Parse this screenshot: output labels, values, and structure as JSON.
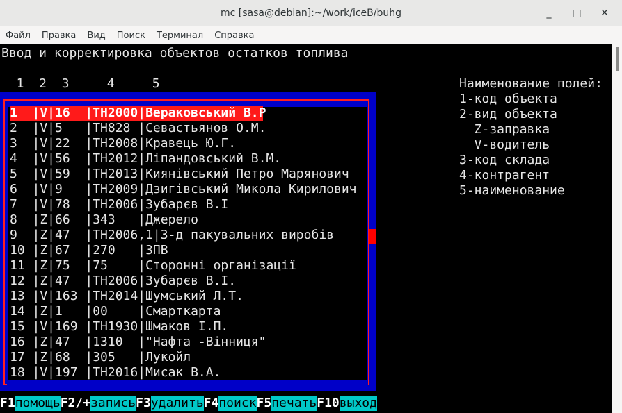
{
  "window": {
    "title": "mc [sasa@debian]:~/work/iceB/buhg",
    "controls": [
      "_",
      "□",
      "✕"
    ]
  },
  "menu": [
    "Файл",
    "Правка",
    "Вид",
    "Поиск",
    "Терминал",
    "Справка"
  ],
  "screen": {
    "heading": "Ввод и корректировка объектов остатков топлива",
    "column_numbers": "  1  2  3     4     5",
    "rows": [
      {
        "text": "1  |V|16  |TH2000|Вераковський В.Р",
        "selected": true
      },
      {
        "text": "2  |V|5   |TH828 |Севастьянов О.М."
      },
      {
        "text": "3  |V|22  |TH2008|Кравець Ю.Г."
      },
      {
        "text": "4  |V|56  |TH2012|Ліпандовський В.М."
      },
      {
        "text": "5  |V|59  |TH2013|Киянівський Петро Марянович"
      },
      {
        "text": "6  |V|9   |TH2009|Дзигівський Микола Кирилович"
      },
      {
        "text": "7  |V|78  |TH2006|Зубарєв В.І"
      },
      {
        "text": "8  |Z|66  |343   |Джерело"
      },
      {
        "text": "9  |Z|47  |TH2006,1|3-д пакувальних виробів"
      },
      {
        "text": "10 |Z|67  |270   |ЗПВ"
      },
      {
        "text": "11 |Z|75  |75    |Сторонні організації"
      },
      {
        "text": "12 |Z|47  |TH2006|Зубарєв В.І."
      },
      {
        "text": "13 |V|163 |TH2014|Шумський Л.Т."
      },
      {
        "text": "14 |Z|1   |00    |Смарткарта"
      },
      {
        "text": "15 |V|169 |TH1930|Шмаков І.П."
      },
      {
        "text": "16 |Z|47  |1310  |\"Нафта -Вінниця\""
      },
      {
        "text": "17 |Z|68  |305   |Лукойл"
      },
      {
        "text": "18 |V|197 |TH2016|Мисак В.А."
      }
    ],
    "legend": [
      "Наименование полей:",
      "1-код объекта",
      "2-вид объекта",
      "  Z-заправка",
      "  V-водитель",
      "3-код склада",
      "4-контрагент",
      "5-наименование"
    ],
    "fkeys": [
      {
        "key": "F1",
        "label": "помощь"
      },
      {
        "key": "F2/+",
        "label": "запись"
      },
      {
        "key": "F3",
        "label": "удалить"
      },
      {
        "key": "F4",
        "label": "поиск"
      },
      {
        "key": "F5",
        "label": "печать"
      },
      {
        "key": "F10",
        "label": "выход"
      }
    ]
  }
}
